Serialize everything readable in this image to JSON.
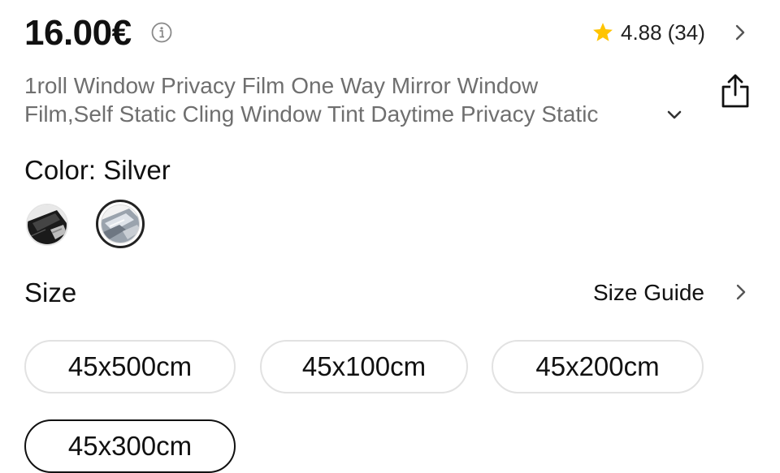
{
  "price": {
    "value": "16.00€"
  },
  "rating": {
    "score": "4.88",
    "count": "(34)",
    "star_color": "#FFC400"
  },
  "title": {
    "line1": "1roll Window Privacy Film One Way Mirror Window",
    "line2": "Film,Self Static Cling Window Tint Daytime Privacy Static"
  },
  "color": {
    "label": "Color: Silver",
    "options": [
      {
        "name": "Black",
        "selected": false
      },
      {
        "name": "Silver",
        "selected": true
      }
    ]
  },
  "size": {
    "label": "Size",
    "guide_label": "Size Guide",
    "options": [
      {
        "label": "45x500cm",
        "selected": false
      },
      {
        "label": "45x100cm",
        "selected": false
      },
      {
        "label": "45x200cm",
        "selected": false
      },
      {
        "label": "45x300cm",
        "selected": true
      }
    ]
  },
  "icons": {
    "info": "info-icon",
    "star": "star-icon",
    "chevron_right": "chevron-right-icon",
    "chevron_down": "chevron-down-icon",
    "share": "share-icon"
  }
}
